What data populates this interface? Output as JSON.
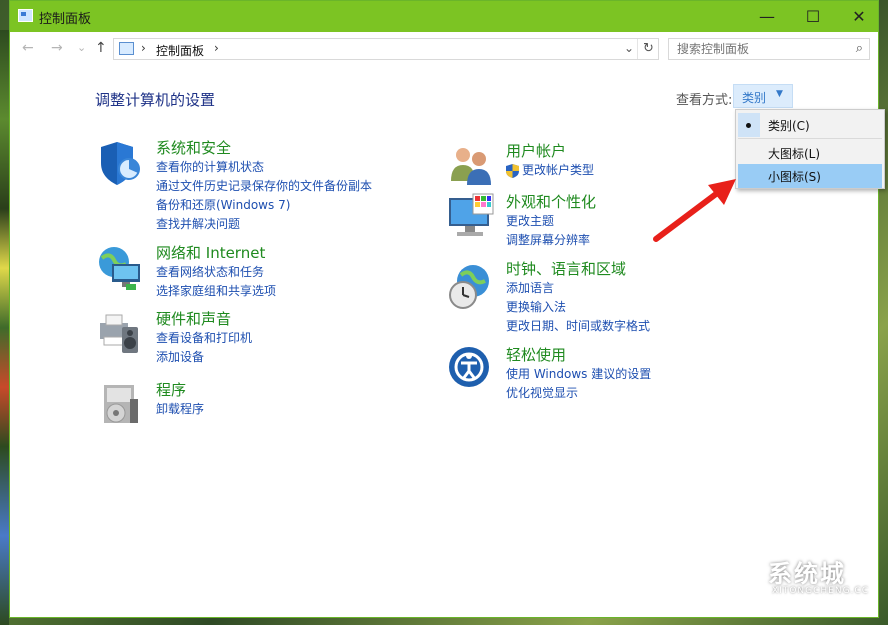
{
  "window": {
    "title": "控制面板",
    "minimize": "—",
    "maximize": "☐",
    "close": "✕"
  },
  "nav": {
    "back": "←",
    "forward": "→",
    "dropdown": "⌄",
    "up": "↑"
  },
  "address": {
    "sep1": "›",
    "path": "控制面板",
    "sep2": "›",
    "dropdown": "⌄",
    "refresh": "↻"
  },
  "search": {
    "placeholder": "搜索控制面板",
    "icon": "⌕"
  },
  "main": {
    "heading": "调整计算机的设置",
    "view_by_label": "查看方式:",
    "view_by_value": "类别",
    "view_by_arrow": "▼"
  },
  "categories_left": [
    {
      "title": "系统和安全",
      "links": [
        "查看你的计算机状态",
        "通过文件历史记录保存你的文件备份副本",
        "备份和还原(Windows 7)",
        "查找并解决问题"
      ]
    },
    {
      "title": "网络和 Internet",
      "links": [
        "查看网络状态和任务",
        "选择家庭组和共享选项"
      ]
    },
    {
      "title": "硬件和声音",
      "links": [
        "查看设备和打印机",
        "添加设备"
      ]
    },
    {
      "title": "程序",
      "links": [
        "卸载程序"
      ]
    }
  ],
  "categories_right": [
    {
      "title": "用户帐户",
      "links": [
        "更改帐户类型"
      ]
    },
    {
      "title": "外观和个性化",
      "links": [
        "更改主题",
        "调整屏幕分辨率"
      ]
    },
    {
      "title": "时钟、语言和区域",
      "links": [
        "添加语言",
        "更换输入法",
        "更改日期、时间或数字格式"
      ]
    },
    {
      "title": "轻松使用",
      "links": [
        "使用 Windows 建议的设置",
        "优化视觉显示"
      ]
    }
  ],
  "menu": {
    "items": [
      "类别(C)",
      "大图标(L)",
      "小图标(S)"
    ],
    "checked": "类别(C)",
    "highlighted": "小图标(S)"
  },
  "watermark": {
    "text": "系统城",
    "sub": "XITONGCHENG.CC"
  },
  "colors": {
    "titlebar": "#7cc423",
    "link": "#1e4fb0",
    "category": "#1f8a1f",
    "heading": "#1e3287",
    "menu_highlight": "#99ccf5",
    "arrow": "#e8201a"
  }
}
